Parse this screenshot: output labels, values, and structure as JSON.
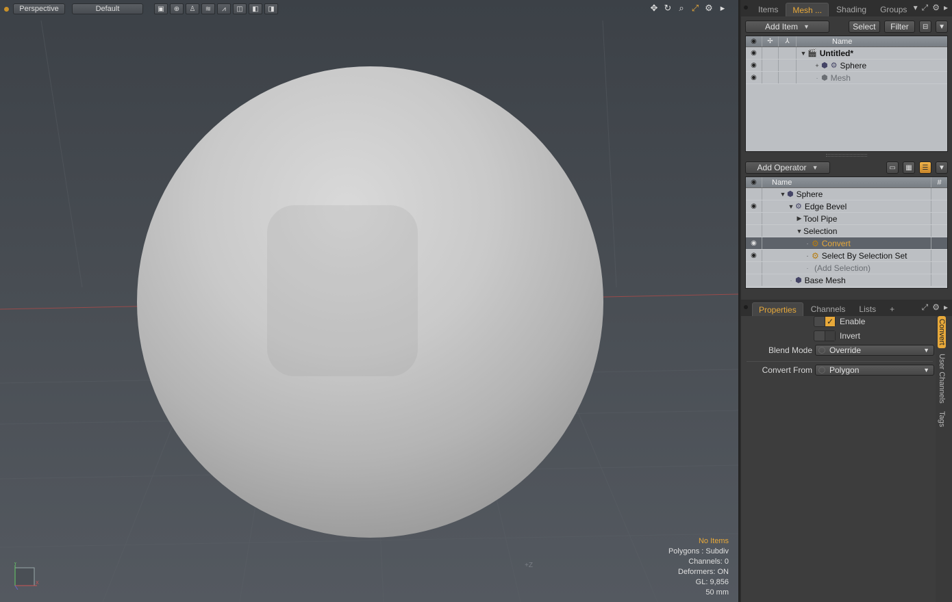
{
  "viewport": {
    "view_label": "Perspective",
    "shading_label": "Default",
    "z_label": "+Z",
    "stats": {
      "items": "No Items",
      "polygons": "Polygons : Subdiv",
      "channels": "Channels: 0",
      "deformers": "Deformers: ON",
      "gl": "GL: 9,856",
      "focal": "50 mm"
    }
  },
  "top_tabs": {
    "items": [
      "Items",
      "Mesh ...",
      "Shading",
      "Groups"
    ],
    "active": "Mesh ..."
  },
  "item_list": {
    "add_item": "Add Item",
    "select": "Select",
    "filter": "Filter",
    "col_name": "Name",
    "rows": [
      {
        "label": "Untitled*"
      },
      {
        "label": "Sphere"
      },
      {
        "label": "Mesh"
      }
    ]
  },
  "operator_list": {
    "add_operator": "Add Operator",
    "col_name": "Name",
    "col_hash": "#",
    "rows": [
      {
        "label": "Sphere"
      },
      {
        "label": "Edge Bevel"
      },
      {
        "label": "Tool Pipe"
      },
      {
        "label": "Selection"
      },
      {
        "label": "Convert"
      },
      {
        "label": "Select By Selection Set"
      },
      {
        "label": "(Add Selection)"
      },
      {
        "label": "Base Mesh"
      }
    ]
  },
  "properties": {
    "tabs": [
      "Properties",
      "Channels",
      "Lists",
      "+"
    ],
    "enable": "Enable",
    "invert": "Invert",
    "blend_mode_label": "Blend Mode",
    "blend_mode_value": "Override",
    "convert_from_label": "Convert From",
    "convert_from_value": "Polygon",
    "side_tabs": [
      "Convert",
      "User Channels",
      "Tags"
    ],
    "accent_color": "#e8a93a"
  }
}
